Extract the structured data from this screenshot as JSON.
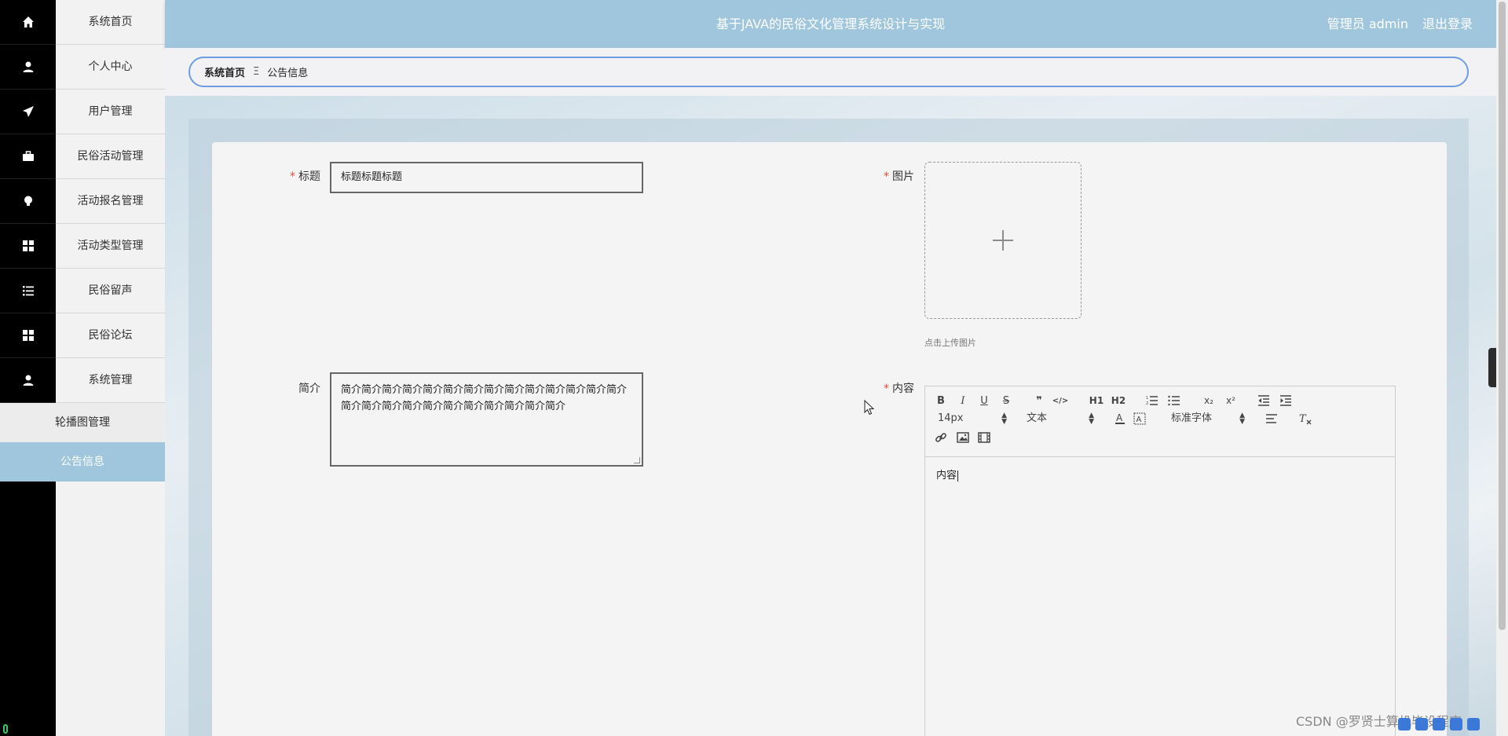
{
  "header": {
    "title": "基于JAVA的民俗文化管理系统设计与实现",
    "user_text": "管理员 admin",
    "logout": "退出登录"
  },
  "sidebar": {
    "items": [
      {
        "label": "系统首页",
        "icon": "home-icon"
      },
      {
        "label": "个人中心",
        "icon": "user-icon"
      },
      {
        "label": "用户管理",
        "icon": "paper-plane-icon"
      },
      {
        "label": "民俗活动管理",
        "icon": "briefcase-icon"
      },
      {
        "label": "活动报名管理",
        "icon": "lightbulb-icon"
      },
      {
        "label": "活动类型管理",
        "icon": "grid-icon"
      },
      {
        "label": "民俗留声",
        "icon": "list-icon"
      },
      {
        "label": "民俗论坛",
        "icon": "grid-icon"
      },
      {
        "label": "系统管理",
        "icon": "user-icon"
      }
    ],
    "subitems": [
      {
        "label": "轮播图管理",
        "active": false
      },
      {
        "label": "公告信息",
        "active": true
      }
    ]
  },
  "breadcrumb": {
    "home": "系统首页",
    "separator": "Ξ",
    "current": "公告信息"
  },
  "form": {
    "title_label": "标题",
    "title_value": "标题标题标题",
    "image_label": "图片",
    "upload_hint": "点击上传图片",
    "intro_label": "简介",
    "intro_value": "简介简介简介简介简介简介简介简介简介简介简介简介简介简介简介简介简介简介简介简介简介简介简介简介简介",
    "content_label": "内容",
    "content_value": "内容"
  },
  "editor": {
    "font_size": "14px",
    "paragraph": "文本",
    "font_family": "标准字体",
    "buttons": {
      "bold": "B",
      "italic": "I",
      "underline": "U",
      "strike": "S",
      "blockquote": "❞",
      "code": "</>",
      "h1": "H1",
      "h2": "H2",
      "subscript": "x₂",
      "superscript": "x²"
    }
  },
  "watermark": "CSDN @罗贤士算机毕设程序",
  "side_tab": "‹"
}
